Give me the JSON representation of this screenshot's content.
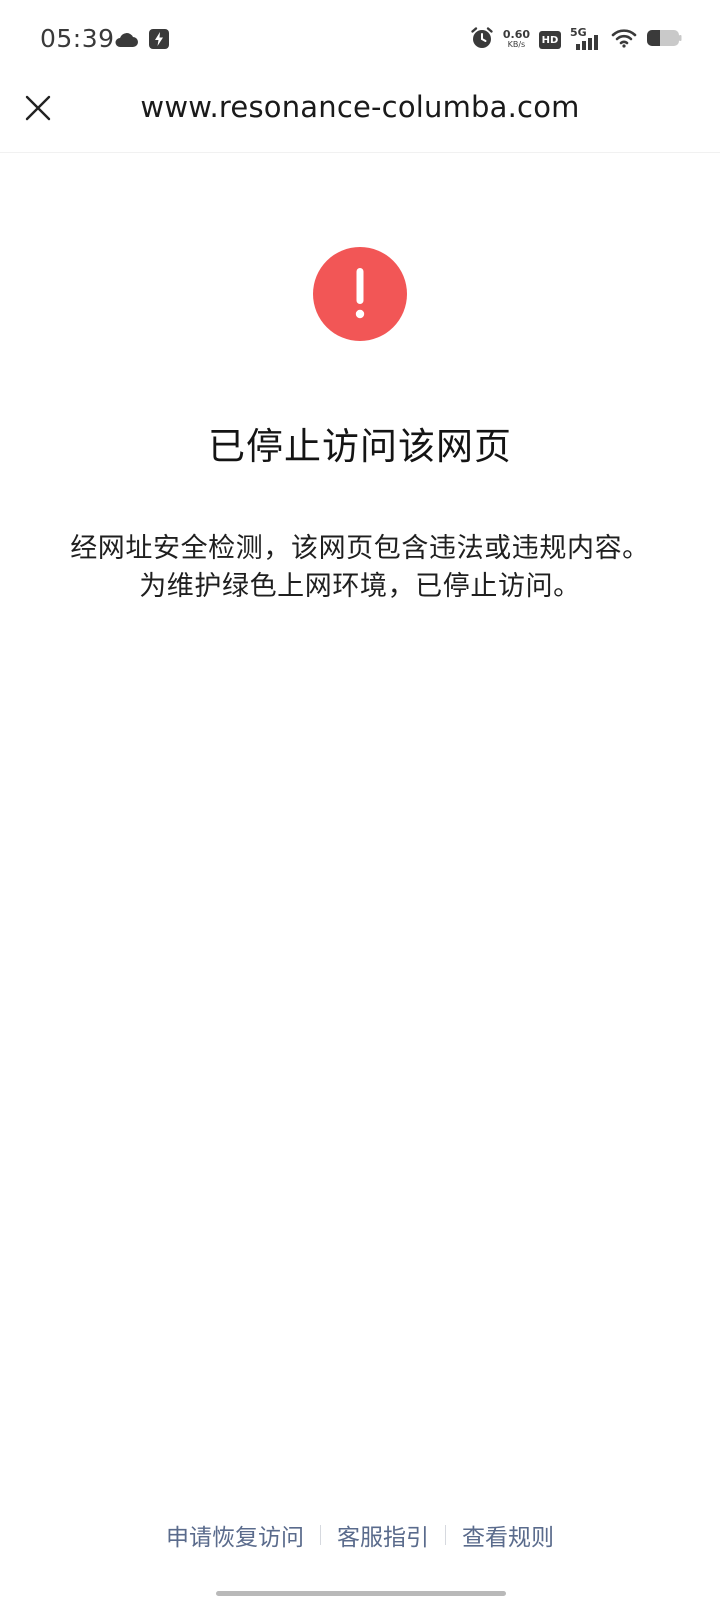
{
  "status_bar": {
    "time": "05:39",
    "net_speed_value": "0.60",
    "net_speed_unit": "KB/s",
    "hd_label": "HD",
    "network_label": "5G",
    "icons": [
      "cloud-icon",
      "flash-icon",
      "alarm-icon",
      "hd-icon",
      "signal-5g-icon",
      "wifi-icon",
      "battery-icon"
    ]
  },
  "header": {
    "title": "www.resonance-columba.com",
    "close_icon": "close-icon"
  },
  "main": {
    "alert_icon": "exclamation-icon",
    "alert_color": "#f25656",
    "title": "已停止访问该网页",
    "description": "经网址安全检测，该网页包含违法或违规内容。为维护绿色上网环境，已停止访问。"
  },
  "footer": {
    "links": [
      {
        "label": "申请恢复访问"
      },
      {
        "label": "客服指引"
      },
      {
        "label": "查看规则"
      }
    ],
    "link_color": "#5a6b8c"
  }
}
